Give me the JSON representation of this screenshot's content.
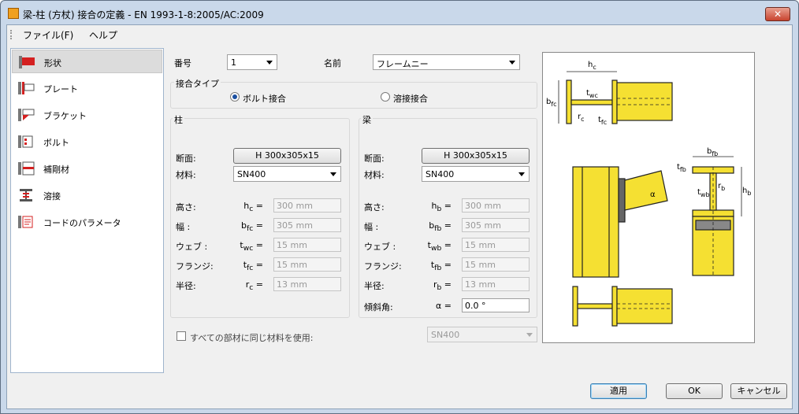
{
  "window": {
    "title": "梁-柱 (方杖) 接合の定義 - EN 1993-1-8:2005/AC:2009",
    "close": "✕"
  },
  "menu": [
    "ファイル(F)",
    "ヘルプ"
  ],
  "nav": [
    {
      "label": "形状",
      "icon": "shape-icon"
    },
    {
      "label": "プレート",
      "icon": "plate-icon"
    },
    {
      "label": "ブラケット",
      "icon": "bracket-icon"
    },
    {
      "label": "ボルト",
      "icon": "bolt-icon"
    },
    {
      "label": "補剛材",
      "icon": "stiffener-icon"
    },
    {
      "label": "溶接",
      "icon": "weld-icon"
    },
    {
      "label": "コードのパラメータ",
      "icon": "code-params-icon"
    }
  ],
  "top": {
    "number_label": "番号",
    "number_value": "1",
    "name_label": "名前",
    "name_value": "フレームニー"
  },
  "connection_type": {
    "label": "接合タイプ",
    "bolted": "ボルト接合",
    "welded": "溶接接合"
  },
  "column": {
    "title": "柱",
    "section_label": "断面:",
    "section_value": "H 300x305x15",
    "material_label": "材料:",
    "material_value": "SN400",
    "rows": [
      {
        "label": "高さ:",
        "sym": "h",
        "sub": "c",
        "value": "300 mm"
      },
      {
        "label": "幅 :",
        "sym": "b",
        "sub": "fc",
        "value": "305 mm"
      },
      {
        "label": "ウェブ :",
        "sym": "t",
        "sub": "wc",
        "value": "15 mm"
      },
      {
        "label": "フランジ:",
        "sym": "t",
        "sub": "fc",
        "value": "15 mm"
      },
      {
        "label": "半径:",
        "sym": "r",
        "sub": "c",
        "value": "13 mm"
      }
    ]
  },
  "beam": {
    "title": "梁",
    "section_label": "断面:",
    "section_value": "H 300x305x15",
    "material_label": "材料:",
    "material_value": "SN400",
    "rows": [
      {
        "label": "高さ:",
        "sym": "h",
        "sub": "b",
        "value": "300 mm"
      },
      {
        "label": "幅 :",
        "sym": "b",
        "sub": "fb",
        "value": "305 mm"
      },
      {
        "label": "ウェブ :",
        "sym": "t",
        "sub": "wb",
        "value": "15 mm"
      },
      {
        "label": "フランジ:",
        "sym": "t",
        "sub": "fb",
        "value": "15 mm"
      },
      {
        "label": "半径:",
        "sym": "r",
        "sub": "b",
        "value": "13 mm"
      }
    ],
    "incline_label": "傾斜角:",
    "incline_sym": "α",
    "incline_value": "0.0 °"
  },
  "same_material": {
    "label": "すべての部材に同じ材料を使用:",
    "value": "SN400"
  },
  "buttons": {
    "apply": "適用",
    "ok": "OK",
    "cancel": "キャンセル"
  },
  "diagram": {
    "hc": "h",
    "hc_sub": "c",
    "bfc": "b",
    "bfc_sub": "fc",
    "twc": "t",
    "twc_sub": "wc",
    "rc": "r",
    "rc_sub": "c",
    "tfc": "t",
    "tfc_sub": "fc",
    "bfb": "b",
    "bfb_sub": "fb",
    "tfb": "t",
    "tfb_sub": "fb",
    "twb": "t",
    "twb_sub": "wb",
    "rb": "r",
    "rb_sub": "b",
    "hb": "h",
    "hb_sub": "b",
    "alpha": "α"
  },
  "colors": {
    "steel": "#f5e032",
    "outline": "#222222",
    "accent": "#cc1111"
  }
}
